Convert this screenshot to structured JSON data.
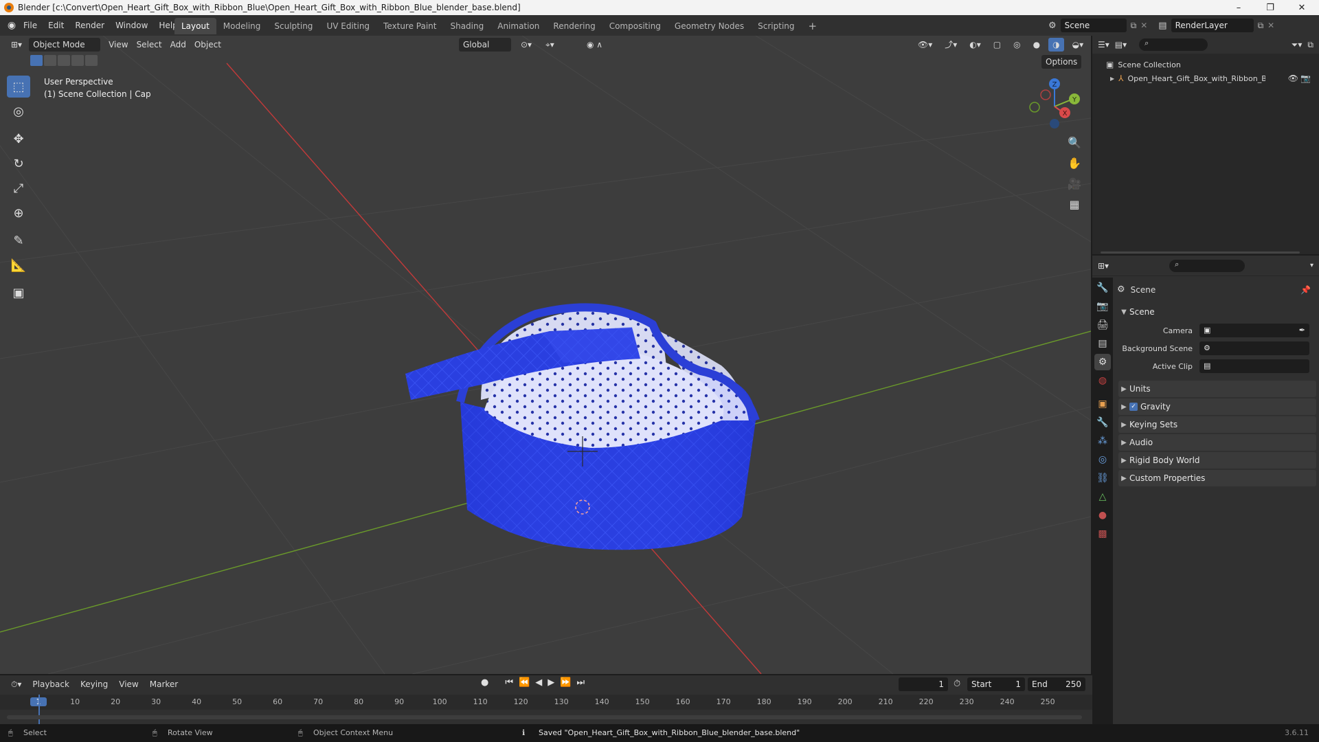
{
  "window": {
    "title": "Blender [c:\\Convert\\Open_Heart_Gift_Box_with_Ribbon_Blue\\Open_Heart_Gift_Box_with_Ribbon_Blue_blender_base.blend]",
    "controls": [
      "–",
      "❐",
      "✕"
    ]
  },
  "menu": [
    "File",
    "Edit",
    "Render",
    "Window",
    "Help"
  ],
  "workspaces": [
    "Layout",
    "Modeling",
    "Sculpting",
    "UV Editing",
    "Texture Paint",
    "Shading",
    "Animation",
    "Rendering",
    "Compositing",
    "Geometry Nodes",
    "Scripting"
  ],
  "workspace_add": "+",
  "topright": {
    "scene": "Scene",
    "view_layer": "RenderLayer"
  },
  "viewport": {
    "mode": "Object Mode",
    "menus": [
      "View",
      "Select",
      "Add",
      "Object"
    ],
    "transform_orientation": "Global",
    "options_label": "Options",
    "overlay_line1": "User Perspective",
    "overlay_line2": "(1) Scene Collection | Cap",
    "axes": {
      "z": "Z",
      "y": "Y",
      "x": "X"
    },
    "tools": [
      "select-box",
      "cursor",
      "move",
      "rotate",
      "scale",
      "transform",
      "annotate",
      "measure",
      "add-cube"
    ],
    "nav": [
      "zoom",
      "pan",
      "camera",
      "ortho"
    ],
    "colors": {
      "x_axis": "#c43a3a",
      "y_axis": "#6a9a2a",
      "box_blue": "#2a3fe0",
      "box_inner": "#e4e6ff"
    }
  },
  "outliner": {
    "root": "Scene Collection",
    "items": [
      {
        "label": "Open_Heart_Gift_Box_with_Ribbon_Blue"
      }
    ]
  },
  "properties": {
    "context_title": "Scene",
    "section": "Scene",
    "fields": [
      {
        "label": "Camera",
        "value": ""
      },
      {
        "label": "Background Scene",
        "value": ""
      },
      {
        "label": "Active Clip",
        "value": ""
      }
    ],
    "panels": [
      {
        "label": "Units",
        "checkbox": false
      },
      {
        "label": "Gravity",
        "checkbox": true
      },
      {
        "label": "Keying Sets",
        "checkbox": false
      },
      {
        "label": "Audio",
        "checkbox": false
      },
      {
        "label": "Rigid Body World",
        "checkbox": false
      },
      {
        "label": "Custom Properties",
        "checkbox": false
      }
    ]
  },
  "timeline": {
    "menus": [
      "Playback",
      "Keying",
      "View",
      "Marker"
    ],
    "current_frame": "1",
    "start_label": "Start",
    "start": "1",
    "end_label": "End",
    "end": "250",
    "ruler": [
      "1",
      "10",
      "20",
      "30",
      "40",
      "50",
      "60",
      "70",
      "80",
      "90",
      "100",
      "110",
      "120",
      "130",
      "140",
      "150",
      "160",
      "170",
      "180",
      "190",
      "200",
      "210",
      "220",
      "230",
      "240",
      "250"
    ]
  },
  "status": {
    "select": "Select",
    "rotate": "Rotate View",
    "context_menu": "Object Context Menu",
    "message": "Saved \"Open_Heart_Gift_Box_with_Ribbon_Blue_blender_base.blend\"",
    "version": "3.6.11"
  }
}
